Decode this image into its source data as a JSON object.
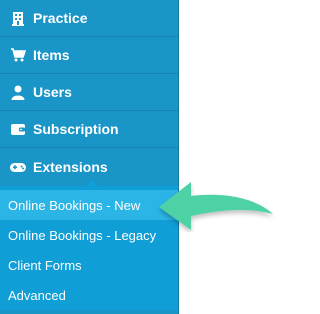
{
  "nav": {
    "items": [
      {
        "label": "Practice",
        "icon": "building-icon"
      },
      {
        "label": "Items",
        "icon": "cart-icon"
      },
      {
        "label": "Users",
        "icon": "user-icon"
      },
      {
        "label": "Subscription",
        "icon": "wallet-icon"
      },
      {
        "label": "Extensions",
        "icon": "gamepad-icon"
      }
    ],
    "submenu": [
      {
        "label": "Online Bookings - New",
        "active": true
      },
      {
        "label": "Online Bookings - Legacy"
      },
      {
        "label": "Client Forms"
      },
      {
        "label": "Advanced"
      }
    ]
  },
  "colors": {
    "sidebar": "#1a95c7",
    "submenu": "#0f9ed5",
    "active": "#2bb4e6",
    "arrow": "#4fd1a6"
  }
}
